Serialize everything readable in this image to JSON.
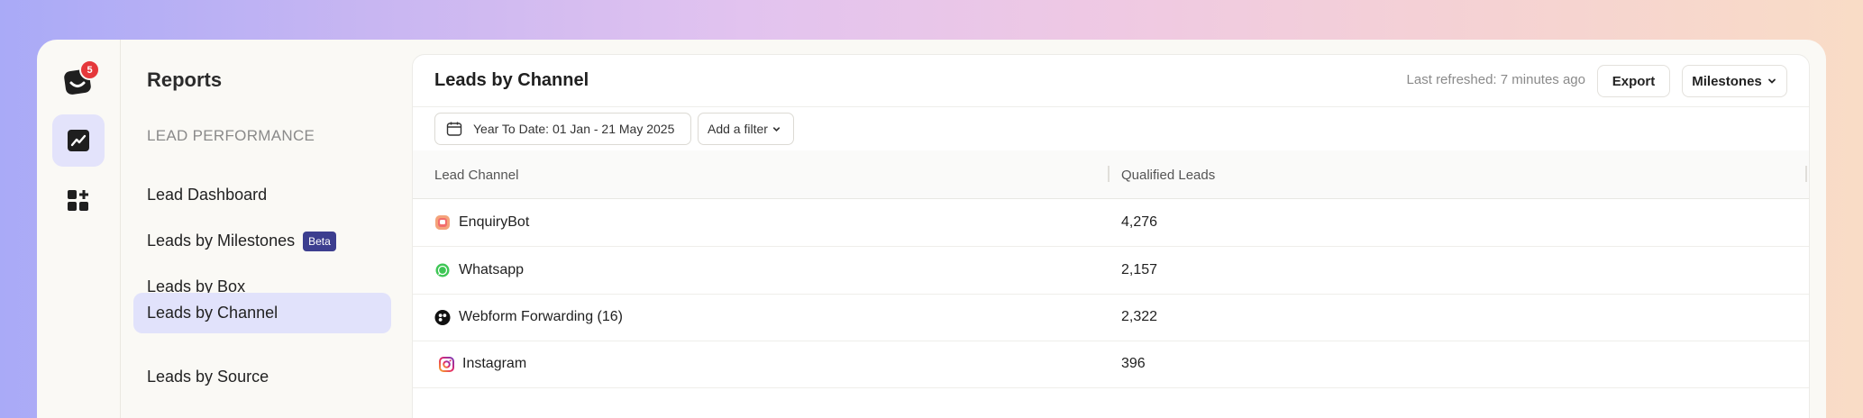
{
  "rail": {
    "notification_count": "5"
  },
  "sidenav": {
    "title": "Reports",
    "section_label": "LEAD PERFORMANCE",
    "items": [
      {
        "label": "Lead Dashboard"
      },
      {
        "label": "Leads by Milestones",
        "badge": "Beta"
      },
      {
        "label": "Leads by Box"
      },
      {
        "label": "Leads by Channel",
        "active": true
      },
      {
        "label": "Leads by Source"
      }
    ]
  },
  "header": {
    "title": "Leads by Channel",
    "last_refreshed": "Last refreshed: 7 minutes ago",
    "export_label": "Export",
    "milestones_label": "Milestones"
  },
  "filters": {
    "date_range": "Year To Date: 01 Jan - 21 May 2025",
    "add_filter": "Add a filter"
  },
  "table": {
    "columns": [
      "Lead Channel",
      "Qualified Leads"
    ],
    "rows": [
      {
        "channel": "EnquiryBot",
        "value": "4,276",
        "icon": "enquirybot-icon"
      },
      {
        "channel": "Whatsapp",
        "value": "2,157",
        "icon": "whatsapp-icon"
      },
      {
        "channel": "Webform Forwarding (16)",
        "value": "2,322",
        "icon": "webform-icon"
      },
      {
        "channel": "Instagram",
        "value": "396",
        "icon": "instagram-icon"
      }
    ]
  },
  "colors": {
    "accent": "#3c3e8f",
    "active_nav": "#e1e2fb",
    "notification": "#e5383b"
  }
}
